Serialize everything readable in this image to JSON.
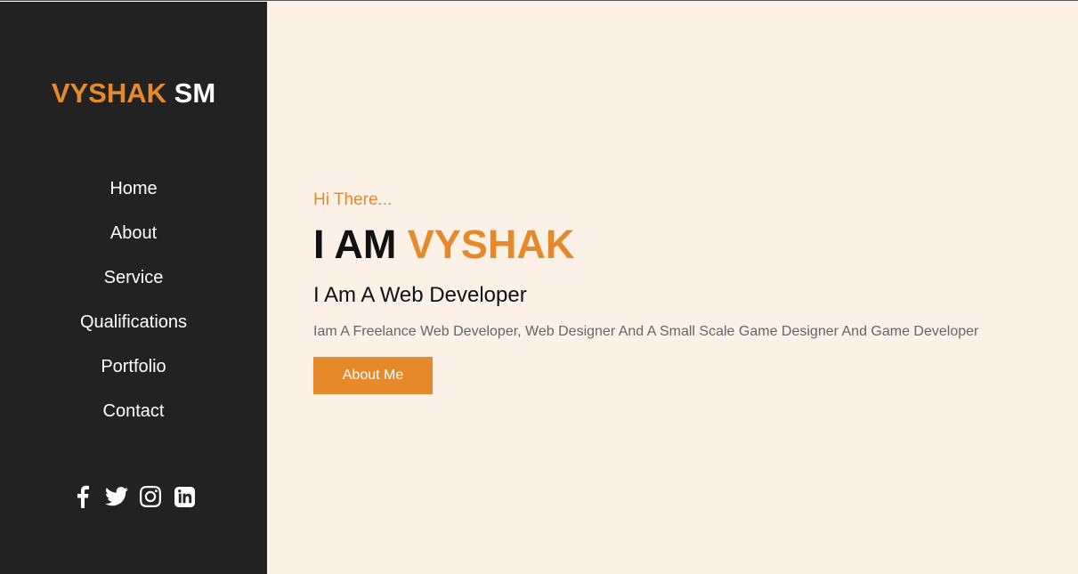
{
  "brand": {
    "first": "VYSHAK",
    "last": "SM",
    "accent_color": "#e5892b"
  },
  "nav": {
    "items": [
      {
        "label": "Home"
      },
      {
        "label": "About"
      },
      {
        "label": "Service"
      },
      {
        "label": "Qualifications"
      },
      {
        "label": "Portfolio"
      },
      {
        "label": "Contact"
      }
    ]
  },
  "social": {
    "icons": [
      "facebook-icon",
      "twitter-icon",
      "instagram-icon",
      "linkedin-icon"
    ]
  },
  "hero": {
    "greeting": "Hi There...",
    "headline_prefix": "I AM",
    "headline_name": "VYSHAK",
    "subtitle": "I Am A Web Developer",
    "description": "Iam A Freelance Web Developer, Web Designer And A Small Scale Game Designer And Game Developer",
    "button_label": "About Me"
  },
  "colors": {
    "sidebar_bg": "#222222",
    "page_bg": "#fcf1e7",
    "accent": "#e5892b"
  }
}
